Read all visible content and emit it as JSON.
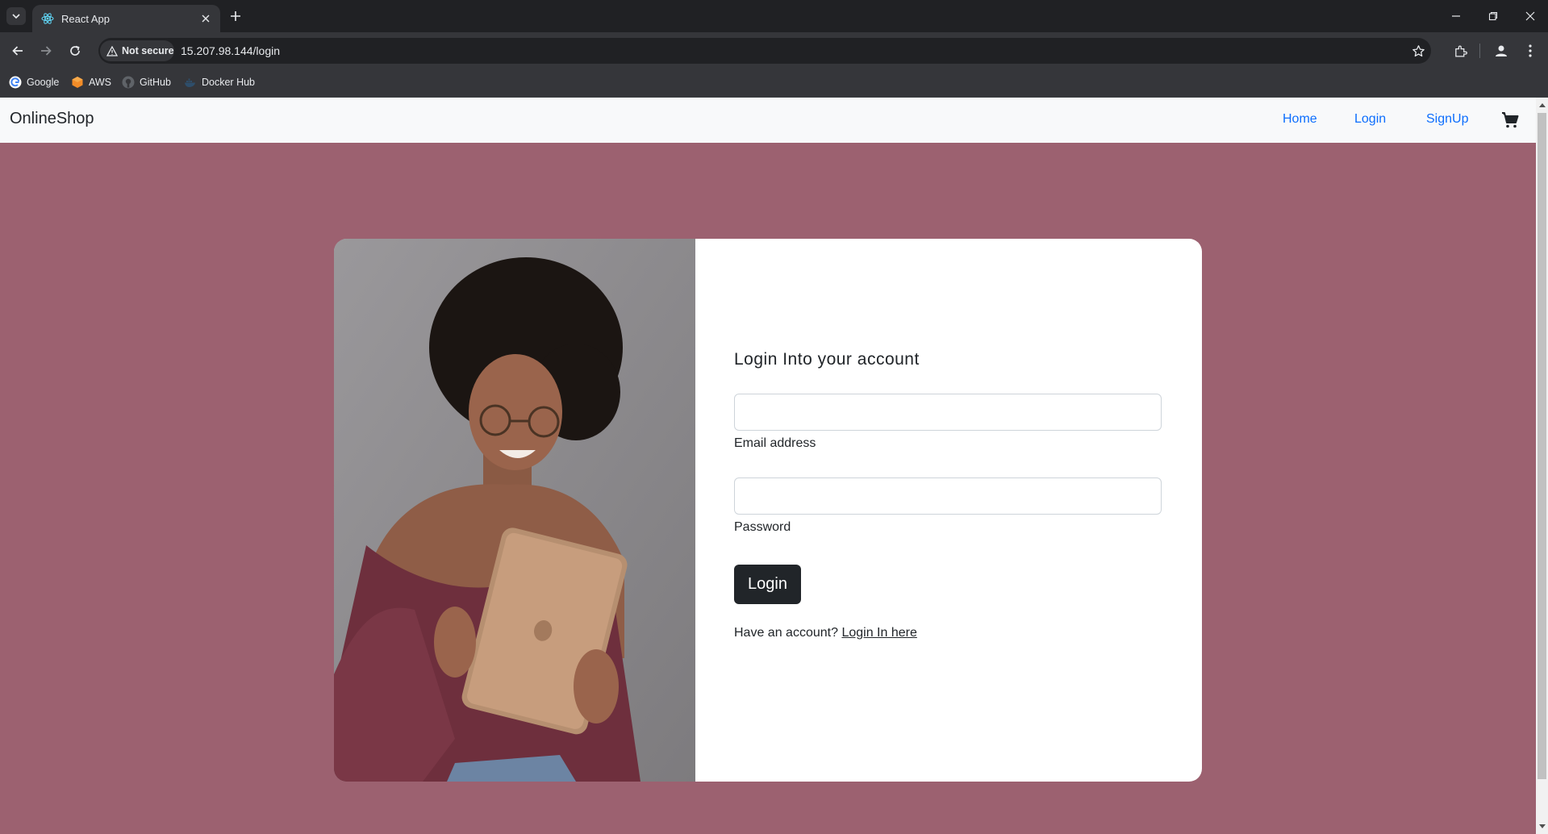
{
  "browser": {
    "tab_title": "React App",
    "security_label": "Not secure",
    "url": "15.207.98.144/login",
    "bookmarks": [
      "Google",
      "AWS",
      "GitHub",
      "Docker Hub"
    ]
  },
  "navbar": {
    "brand": "OnlineShop",
    "links": [
      "Home",
      "Login",
      "SignUp"
    ]
  },
  "login_form": {
    "title": "Login Into your account",
    "email_label": "Email address",
    "email_value": "",
    "password_label": "Password",
    "password_value": "",
    "submit_label": "Login",
    "account_prompt": "Have an account?",
    "account_link": "Login In here"
  },
  "colors": {
    "page_background": "#9c6170",
    "link": "#0d6efd",
    "button": "#212529"
  },
  "icons": [
    "tab-search-icon",
    "react-favicon-icon",
    "close-icon",
    "new-tab-icon",
    "back-icon",
    "forward-icon",
    "reload-icon",
    "warning-icon",
    "star-icon",
    "extensions-icon",
    "profile-icon",
    "more-icon",
    "cart-icon"
  ]
}
